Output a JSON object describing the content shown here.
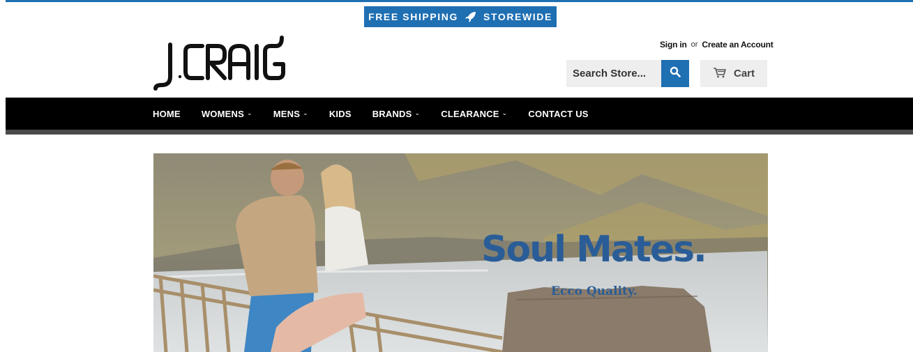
{
  "promo": {
    "text_left": "FREE SHIPPING",
    "text_right": "STOREWIDE",
    "icon": "rocket-icon"
  },
  "logo": {
    "alt": "J.CRAIG"
  },
  "account": {
    "sign_in": "Sign in",
    "or": "or",
    "create": "Create an Account"
  },
  "search": {
    "placeholder": "Search Store...",
    "icon": "search-icon"
  },
  "cart": {
    "label": "Cart",
    "icon": "cart-icon"
  },
  "nav": {
    "items": [
      {
        "label": "HOME",
        "dropdown": false
      },
      {
        "label": "WOMENS",
        "dropdown": true
      },
      {
        "label": "MENS",
        "dropdown": true
      },
      {
        "label": "KIDS",
        "dropdown": false
      },
      {
        "label": "BRANDS",
        "dropdown": true
      },
      {
        "label": "CLEARANCE",
        "dropdown": true
      },
      {
        "label": "CONTACT US",
        "dropdown": false
      }
    ]
  },
  "hero": {
    "title": "Soul Mates.",
    "subtitle": "Ecco Quality."
  },
  "colors": {
    "brand_blue": "#1f6fb3",
    "nav_bg": "#000000",
    "hero_text": "#2a5d97"
  }
}
